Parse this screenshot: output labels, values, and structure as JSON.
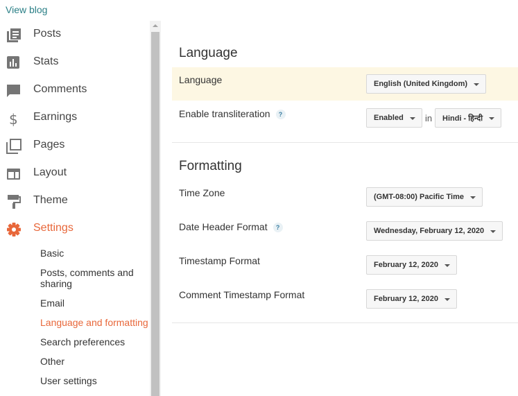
{
  "header": {
    "view_blog": "View blog"
  },
  "nav": {
    "posts": "Posts",
    "stats": "Stats",
    "comments": "Comments",
    "earnings": "Earnings",
    "pages": "Pages",
    "layout": "Layout",
    "theme": "Theme",
    "settings": "Settings"
  },
  "settings_sub": {
    "basic": "Basic",
    "posts_comments": "Posts, comments and sharing",
    "email": "Email",
    "language": "Language and formatting",
    "search": "Search preferences",
    "other": "Other",
    "user": "User settings"
  },
  "language_section": {
    "title": "Language",
    "language_label": "Language",
    "language_value": "English (United Kingdom)",
    "transliteration_label": "Enable transliteration",
    "transliteration_value": "Enabled",
    "in_text": "in",
    "transliteration_lang": "Hindi - हिन्दी"
  },
  "formatting_section": {
    "title": "Formatting",
    "timezone_label": "Time Zone",
    "timezone_value": "(GMT-08:00) Pacific Time",
    "date_header_label": "Date Header Format",
    "date_header_value": "Wednesday, February 12, 2020",
    "timestamp_label": "Timestamp Format",
    "timestamp_value": "February 12, 2020",
    "comment_timestamp_label": "Comment Timestamp Format",
    "comment_timestamp_value": "February 12, 2020"
  },
  "help_glyph": "?",
  "colors": {
    "accent": "#e8673a",
    "link": "#2a7f86",
    "highlight": "#fdf7e3"
  }
}
